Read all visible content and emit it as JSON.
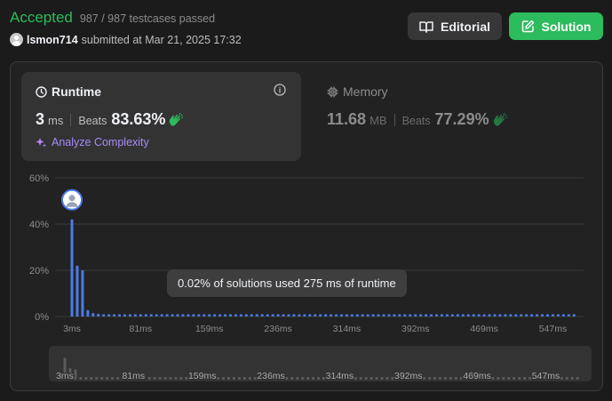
{
  "submission": {
    "status": "Accepted",
    "testcases": "987 / 987 testcases passed",
    "username": "lsmon714",
    "submitted_at": "submitted at Mar 21, 2025 17:32"
  },
  "buttons": {
    "editorial": "Editorial",
    "solution": "Solution"
  },
  "runtime": {
    "title": "Runtime",
    "value": "3",
    "unit": "ms",
    "beats_label": "Beats",
    "beats_pct": "83.63%",
    "analyze": "Analyze Complexity"
  },
  "memory": {
    "title": "Memory",
    "value": "11.68",
    "unit": "MB",
    "beats_label": "Beats",
    "beats_pct": "77.29%"
  },
  "tooltip": "0.02% of solutions used 275 ms of runtime",
  "colors": {
    "accent_green": "#2cbb5d",
    "bar_blue": "#4a7be8",
    "analyze_purple": "#a78bfa",
    "hands_green": "#2cbb5d"
  },
  "icons": {
    "editorial": "book-icon",
    "solution": "edit-icon",
    "runtime": "clock-icon",
    "memory": "chip-icon",
    "info": "info-icon",
    "analyze": "sparkle-icon",
    "beats": "clapping-hands-icon"
  },
  "chart_data": {
    "type": "bar",
    "ylabels": [
      "60%",
      "40%",
      "20%",
      "0%"
    ],
    "yticks": [
      60,
      40,
      20,
      0
    ],
    "ylim": [
      0,
      60
    ],
    "xtick_labels": [
      "3ms",
      "81ms",
      "159ms",
      "236ms",
      "314ms",
      "392ms",
      "469ms",
      "547ms"
    ],
    "xtick_index": [
      0,
      13,
      26,
      39,
      52,
      65,
      78,
      91
    ],
    "user_bar_index": 0,
    "series": [
      {
        "values": [
          42,
          22,
          20,
          2.8,
          1.5,
          1.2,
          1,
          1,
          1,
          1,
          1,
          1,
          1,
          1,
          1,
          1,
          1,
          1,
          1,
          1,
          1,
          1,
          1,
          1,
          1,
          1,
          1,
          1,
          1,
          1,
          1,
          1,
          1,
          1,
          1,
          1,
          1,
          1,
          1,
          1,
          1,
          1,
          1,
          1,
          1,
          1,
          1,
          1,
          1,
          1,
          1,
          1,
          1,
          1,
          1,
          1,
          1,
          1,
          1,
          1,
          1,
          1,
          1,
          1,
          1,
          1,
          1,
          1,
          1,
          1,
          1,
          1,
          1,
          1,
          1,
          1,
          1,
          1,
          1,
          1,
          1,
          1,
          1,
          1,
          1,
          1,
          1,
          1,
          1,
          1,
          1,
          1,
          1,
          1,
          1,
          1,
          1,
          1,
          1,
          1,
          1,
          1
        ]
      }
    ],
    "overview": {
      "xtick_labels": [
        "3ms",
        "81ms",
        "159ms",
        "236ms",
        "314ms",
        "392ms",
        "469ms",
        "547ms"
      ],
      "values": [
        42,
        22,
        20,
        2.8,
        1.5,
        1.2,
        1,
        1,
        1,
        1,
        1,
        1,
        1,
        1,
        1,
        1,
        1,
        1,
        1,
        1,
        1,
        1,
        1,
        1,
        1,
        1,
        1,
        1,
        1,
        1,
        1,
        1,
        1,
        1,
        1,
        1,
        1,
        1,
        1,
        1,
        1,
        1,
        1,
        1,
        1,
        1,
        1,
        1,
        1,
        1,
        1,
        1,
        1,
        1,
        1,
        1,
        1,
        1,
        1,
        1,
        1,
        1,
        1,
        1,
        1,
        1,
        1,
        1,
        1,
        1,
        1,
        1,
        1,
        1,
        1,
        1,
        1,
        1,
        1,
        1,
        1,
        1,
        1,
        1,
        1,
        1,
        1,
        1,
        1,
        1,
        1,
        1,
        1,
        1,
        1,
        1,
        1,
        1,
        1,
        1,
        1,
        1
      ]
    }
  }
}
